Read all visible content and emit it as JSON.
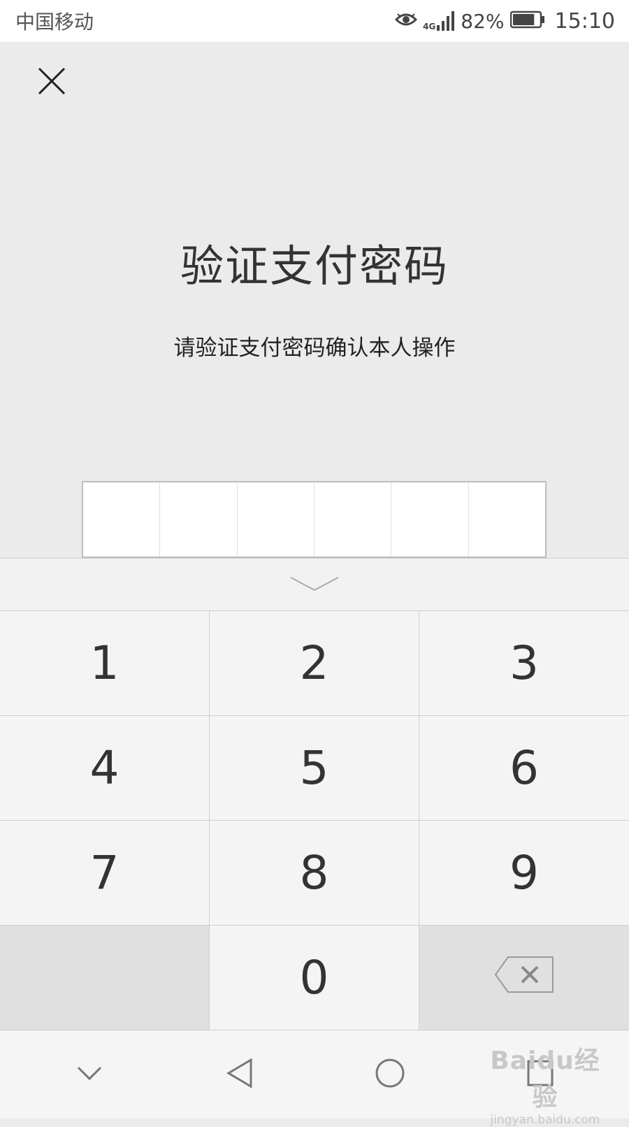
{
  "status_bar": {
    "carrier": "中国移动",
    "network": "4G",
    "battery_percent": "82%",
    "battery_level": 0.82,
    "time": "15:10"
  },
  "dialog": {
    "title": "验证支付密码",
    "subtitle": "请验证支付密码确认本人操作",
    "pin_length": 6
  },
  "keypad": {
    "keys": [
      "1",
      "2",
      "3",
      "4",
      "5",
      "6",
      "7",
      "8",
      "9",
      "",
      "0",
      "backspace"
    ]
  },
  "watermark": {
    "logo": "Baidu经验",
    "url": "jingyan.baidu.com"
  },
  "icons": [
    "eye-icon",
    "signal-icon",
    "battery-icon",
    "close-icon",
    "chevron-down-icon",
    "backspace-icon",
    "nav-back-icon",
    "nav-home-icon",
    "nav-recents-icon",
    "nav-hide-icon"
  ]
}
